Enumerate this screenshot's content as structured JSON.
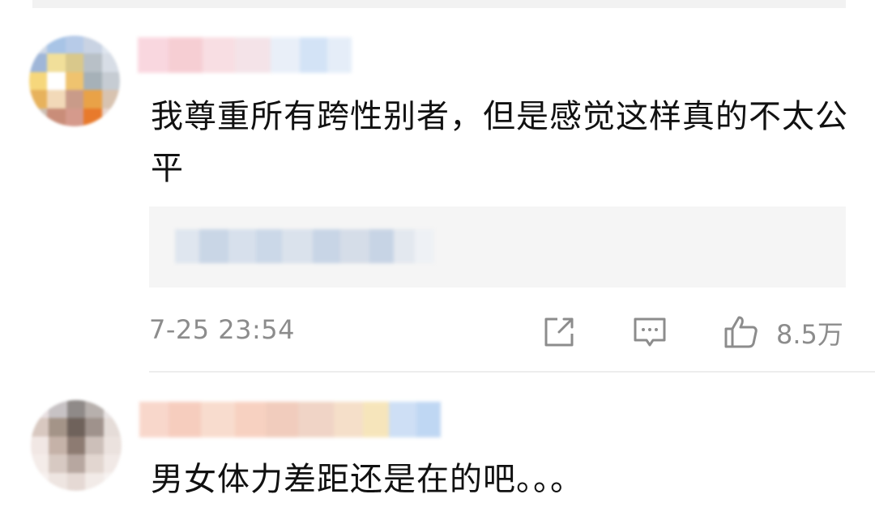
{
  "comments": [
    {
      "text": "我尊重所有跨性别者，但是感觉这样真的不太公平",
      "timestamp": "7-25 23:54",
      "likes": "8.5万",
      "icons": [
        "share-icon",
        "comment-icon",
        "like-icon"
      ]
    },
    {
      "text": "男女体力差距还是在的吧。。。"
    }
  ],
  "colors": {
    "text": "#111111",
    "meta": "#8c8c8c",
    "reply_bg": "#f5f5f5"
  }
}
